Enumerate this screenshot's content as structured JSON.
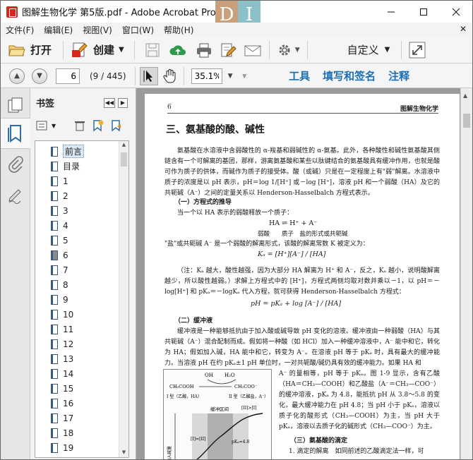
{
  "window": {
    "title": "图解生物化学 第5版.pdf - Adobe Acrobat Pro",
    "overlay_letters": [
      "D",
      "I"
    ]
  },
  "menu": [
    "文件(F)",
    "编辑(E)",
    "视图(V)",
    "窗口(W)",
    "帮助(H)"
  ],
  "toolbar": {
    "open_label": "打开",
    "create_label": "创建",
    "customize_label": "自定义"
  },
  "nav": {
    "current_page": "6",
    "page_count": "(9 / 445)",
    "zoom": "35.1%"
  },
  "right_links": [
    "工具",
    "填写和签名",
    "注释"
  ],
  "bookmarks": {
    "title": "书签",
    "items": [
      "前言",
      "目录",
      "1",
      "2",
      "3",
      "4",
      "5",
      "6",
      "7",
      "8",
      "9",
      "10",
      "11",
      "12",
      "13",
      "14",
      "15",
      "16",
      "17",
      "18",
      "19"
    ],
    "selected_index": 0
  },
  "page": {
    "page_number": "6",
    "running_header": "图解生物化学",
    "section_title": "三、氨基酸的酸、碱性",
    "para1": "氨基酸在水溶液中含弱酸性的 α-羧基和弱碱性的 α-氨基。此外，各种酸性和碱性氨基酸其侧链含有一个可解离的基团，那样，游离氨基酸和某些以肽键结合的氨基酸具有缓冲作用，也就是酸可作为质子的供体，而碱作为质子的接受体。酸（或碱）只是在一定程度上有\"弱\"解离。水溶液中质子的浓度是以 pH 表示，pH＝log 1/[H⁺] 或－log [H⁺]，溶液 pH 和一个弱酸（HA）及它的共轭碱（A⁻）之间的定量关系以 Henderson-Hasselbalch 方程式表示。",
    "sub1": "（一）方程式的推导",
    "para2": "当一个以 HA 表示的弱酸释放一个质子：",
    "equation1": "HA ⇌ H⁺ + A⁻",
    "equation1_labels": "弱酸　　质子　盐的形式或共轭碱",
    "para3": "\"盐\"或共轭碱 A⁻ 是一个弱酸的解离形式，该酸的解离常数 K 被定义为：",
    "equation2": "Kₐ = [H⁺][A⁻] / [HA]",
    "para4": "（注：Kₐ 越大，酸性越强，因为大部分 HA 解离为 H⁺ 和 A⁻，反之，Kₐ 越小，说明酸解离越少，所以酸性越弱。）求解上方程式中的 [H⁺]，方程式两侧均取对数并乘以－1，以 pH＝－log[H⁺] 和 pKₐ＝－logKₐ 代入方程，就可获得 Henderson-Hasselbalch 方程式：",
    "equation3": "pH = pKₐ + log [A⁻] / [HA]",
    "sub2": "（二）缓冲液",
    "para5": "缓冲液是一种能够抵抗由于加入酸或碱导致 pH 变化的溶液。缓冲液由一种弱酸（HA）与其共轭碱（A⁻）混合配制而成。假如将一种酸（如 HCl）加入一种缓冲溶液中，A⁻ 能中和它，转化为 HA；假如加入碱，HA 能中和它，转变为 A⁻。在溶液 pH 等于 pKₐ 时，具有最大的缓冲能力。当溶液 pH 在约 pKₐ±1 pH 单位时，一对共轭酸/碱仍具有效的缓冲能力。如果 HA 和",
    "para6": "A⁻ 的量相等，pH 等于 pKₐ。图 1-9 显示，含有乙酸（HA＝CH₃—COOH）和乙酸盐（A⁻＝CH₃—COO⁻）的缓冲溶液，pKₐ 为 4.8，能抵抗 pH 从 3.8～5.8 的变化，最大缓冲能力在 pH 4.8；当 pH 小于 pKₐ，溶液以质子化的酸形式（CH₃—COOH）为主，当 pH 大于 pKₐ，溶液以去质子化的碱形式（CH₃—COO⁻）为主。",
    "sub3": "（三）氨基酸的滴定",
    "para7": "1. 滴定的解离　如同前述的乙酸滴定法一样，可",
    "figure_labels": {
      "oh": "OH",
      "h2o": "H₂O",
      "acid": "CH₃COOH",
      "base": "CH₃COO⁻",
      "acid_caption": "I 型（乙酸，HA）",
      "base_caption": "II 型（乙酸盐，A⁻）",
      "buffer_region": "缓冲区间",
      "ratio_right": "[II]>[I]",
      "ratio_eq": "[I]=[II]",
      "pka": "pKₐ=4.8",
      "yaxis": "加入碱量"
    }
  }
}
